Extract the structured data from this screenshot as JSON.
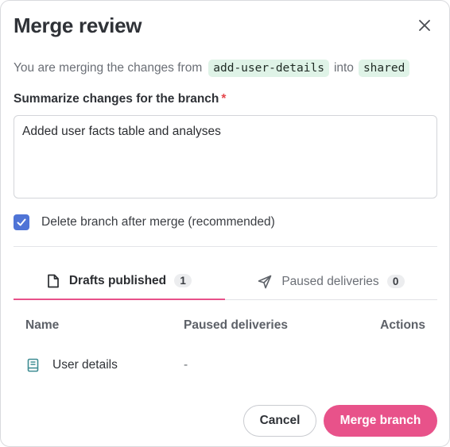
{
  "dialog": {
    "title": "Merge review"
  },
  "merge_info": {
    "prefix": "You are merging the changes from",
    "source_branch": "add-user-details",
    "connector": "into",
    "target_branch": "shared"
  },
  "summary_field": {
    "label": "Summarize changes for the branch",
    "required_marker": "*",
    "value": "Added user facts table and analyses"
  },
  "delete_branch": {
    "label": "Delete branch after merge (recommended)",
    "checked": true
  },
  "tabs": [
    {
      "label": "Drafts published",
      "count": "1",
      "icon": "document-icon",
      "active": true
    },
    {
      "label": "Paused deliveries",
      "count": "0",
      "icon": "send-icon",
      "active": false
    }
  ],
  "table": {
    "columns": [
      "Name",
      "Paused deliveries",
      "Actions"
    ],
    "rows": [
      {
        "icon": "book-icon",
        "name": "User details",
        "paused": "-"
      }
    ]
  },
  "footer": {
    "cancel_label": "Cancel",
    "merge_label": "Merge branch"
  },
  "colors": {
    "accent": "#e8528a",
    "checkbox": "#4f74d6",
    "code_chip_bg": "#dff3e7",
    "required": "#e5484d"
  }
}
